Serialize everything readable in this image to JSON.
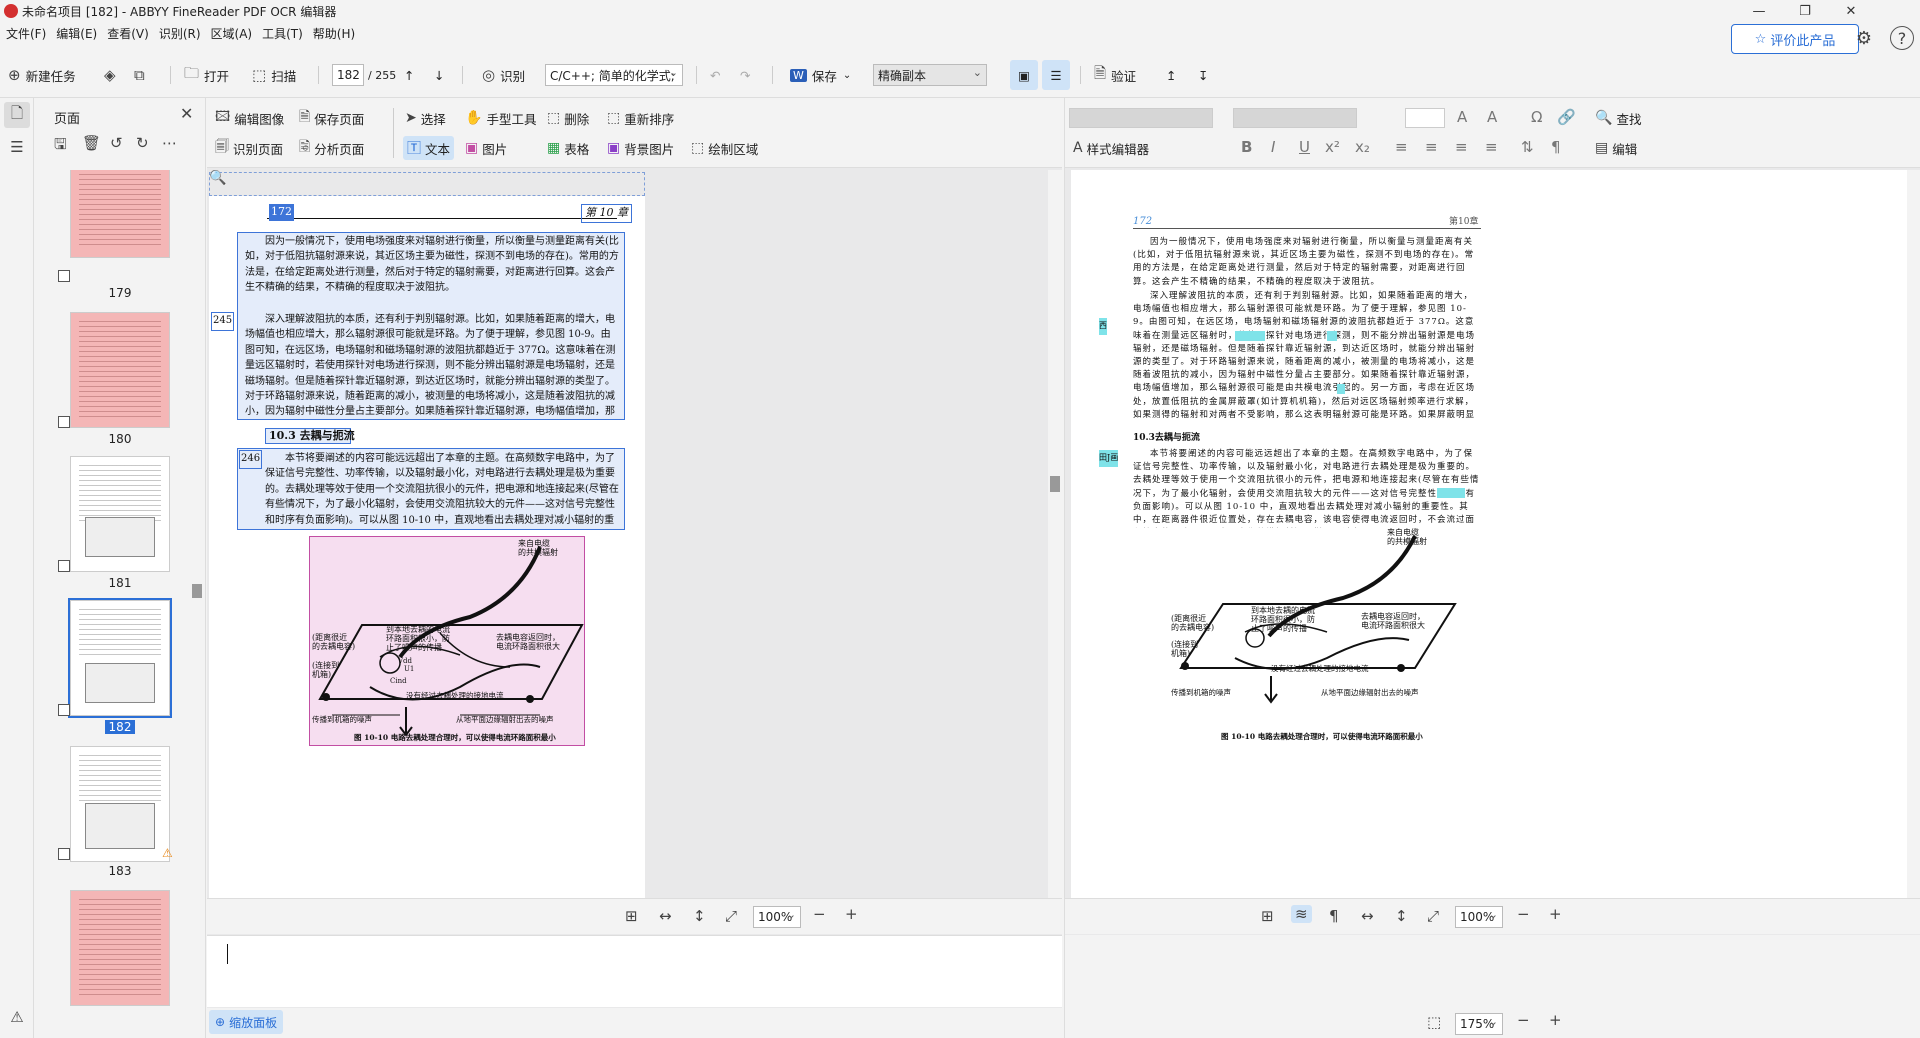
{
  "window": {
    "title": "未命名项目 [182] - ABBYY FineReader PDF OCR 编辑器"
  },
  "menu": [
    "文件(F)",
    "编辑(E)",
    "查看(V)",
    "识别(R)",
    "区域(A)",
    "工具(T)",
    "帮助(H)"
  ],
  "header": {
    "rate_label": "评价此产品"
  },
  "toolbar": {
    "new_task": "新建任务",
    "open": "打开",
    "scan": "扫描",
    "page_current": "182",
    "page_total": "/ 255",
    "recognize": "识别",
    "language": "C/C++; 简单的化学式;",
    "save": "保存",
    "save_mode": "精确副本",
    "verify": "验证"
  },
  "pages_panel": {
    "title": "页面",
    "thumbs": [
      {
        "label": "179"
      },
      {
        "label": "180"
      },
      {
        "label": "181"
      },
      {
        "label": "182"
      },
      {
        "label": "183"
      }
    ]
  },
  "image_tools": {
    "edit_image": "编辑图像",
    "save_page": "保存页面",
    "select": "选择",
    "hand": "手型工具",
    "delete": "删除",
    "reorder": "重新排序",
    "recognize_page": "识别页面",
    "analyze_page": "分析页面",
    "text": "文本",
    "picture": "图片",
    "table": "表格",
    "bg_picture": "背景图片",
    "draw_area": "绘制区域"
  },
  "text_tools": {
    "find": "查找",
    "style_editor": "样式编辑器",
    "edit": "编辑"
  },
  "document": {
    "page_number": "172",
    "chapter": "第 10 章",
    "margin_245": "245",
    "margin_246": "246",
    "para1": "因为一般情况下，使用电场强度来对辐射进行衡量，所以衡量与测量距离有关(比如，对于低阻抗辐射源来说，其近区场主要为磁性，探测不到电场的存在)。常用的方法是，在给定距离处进行测量，然后对于特定的辐射需要，对距离进行回算。这会产生不精确的结果，不精确的程度取决于波阻抗。",
    "para2": "深入理解波阻抗的本质，还有利于判别辐射源。比如，如果随着距离的增大，电场幅值也相应增大，那么辐射源很可能就是环路。为了便于理解，参见图 10-9。由图可知，在远区场，电场辐射和磁场辐射源的波阻抗都趋近于 377Ω。这意味着在测量远区辐射时，若使用探针对电场进行探测，则不能分辨出辐射源是电场辐射，还是磁场辐射。但是随着探针靠近辐射源，到达近区场时，就能分辨出辐射源的类型了。对于环路辐射源来说，随着距离的减小，被测量的电场将减小，这是随着波阻抗的减小，因为辐射中磁性分量占主要部分。如果随着探针靠近辐射源，电场幅值增加，那么辐射源很可能是由共模电流引起的。另一方面，考虑在近区场处，放置低阻抗的金属屏蔽罩(如计算机机箱)，然后对远区场辐射频率进行求解，如果测得的辐射和对两者不受影响，那么这表明辐射源可能是环路。如果屏蔽明显降低了辐射的幅值，那么辐射源很可能是共模电流。",
    "heading": "10.3  去耦与扼流",
    "para3": "本节将要阐述的内容可能远远超出了本章的主题。在高频数字电路中，为了保证信号完整性、功率传输，以及辐射最小化，对电路进行去耦处理是极为重要的。去耦处理等效于使用一个交流阻抗很小的元件，把电源和地连接起来(尽管在有些情况下，为了最小化辐射，会使用交流阻抗较大的元件——这对信号完整性和时序有负面影响)。可以从图 10-10 中，直观地看出去耦处理对减小辐射的重要性。其中，在距离器件很近位置处，存在去耦电容，该电容使得电流返回时，不会流过面积较大的环路，而且也不会像共模辐射源一样，通过电",
    "fig_caption": "图 10-10   电路去耦处理合理时，可以使得电流环路面积最小",
    "fig_labels": {
      "cable": "来自电缆\n的共模辐射",
      "chip": "(距离很近\n的去耦电容)",
      "noise": "到本地去耦的电流\n环路面积很小，防\n止了噪声的传播",
      "return": "去耦电容返回时，\n电流环路面积很大",
      "chassis": "(连接到\n机箱)",
      "vdd": "Vdd",
      "u1": "U1",
      "cind": "Cind",
      "nodecouple": "没有经过去耦处理的接地电流",
      "outer": "从地平面边缘辐射出去的噪声",
      "spread": "传播到机箱的噪声"
    }
  },
  "right_doc": {
    "page_number": "172",
    "chapter": "第10章",
    "margin_a": "西",
    "margin_b": "田J画",
    "heading": "10.3去耦与扼流"
  },
  "zoom": {
    "image_zoom": "100%",
    "text_zoom": "100%",
    "bottom_zoom": "175%",
    "zoom_panel": "缩放面板"
  },
  "colors": {
    "accent": "#2b6fd6",
    "text_area": "#3d74d8",
    "picture_area": "#c24ea3",
    "highlight": "#7fe3e9"
  }
}
